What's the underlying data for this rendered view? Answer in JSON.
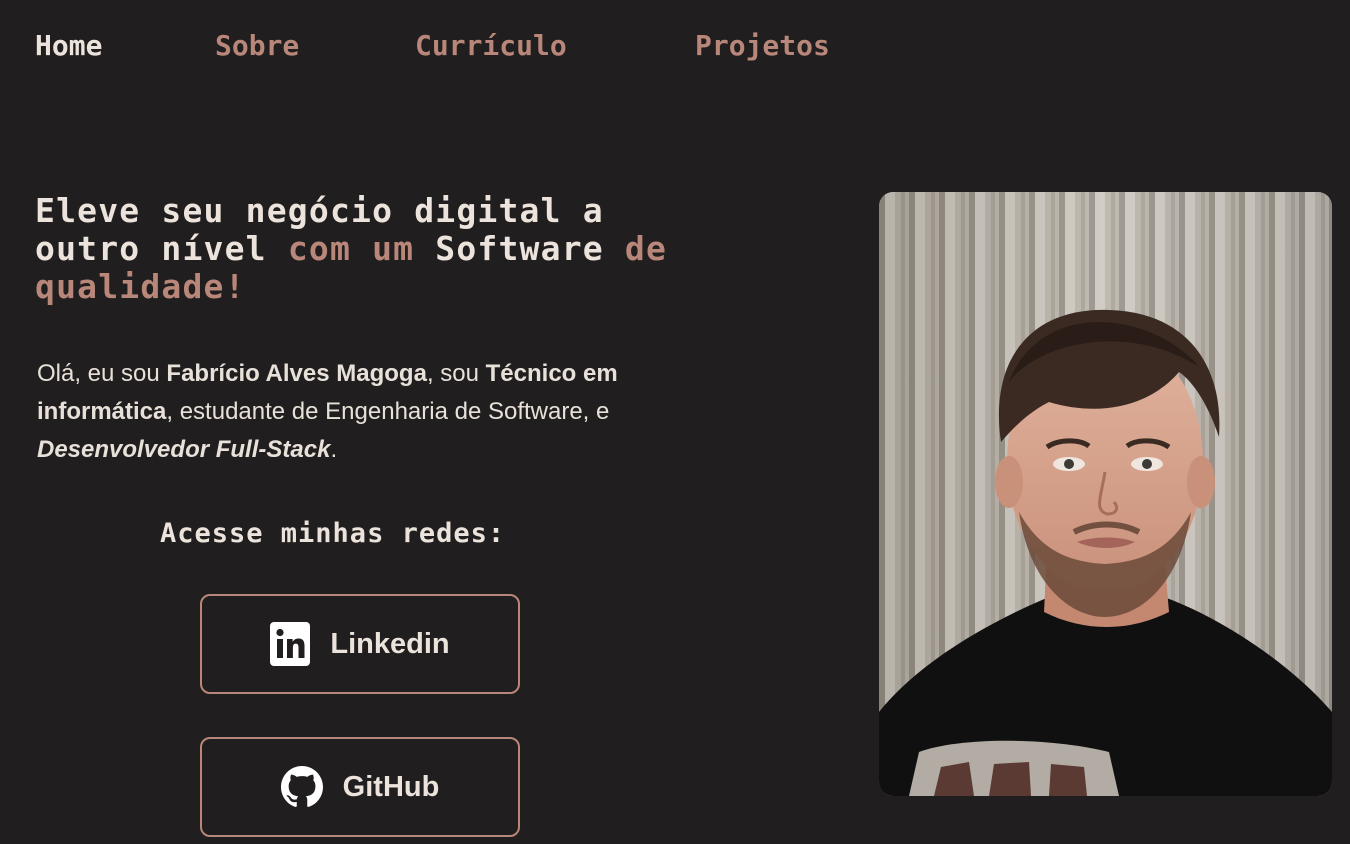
{
  "nav": {
    "home": "Home",
    "sobre": "Sobre",
    "curriculo": "Currículo",
    "projetos": "Projetos"
  },
  "hero": {
    "headline_part1": "Eleve seu negócio digital a outro nível ",
    "headline_accent1": "com um",
    "headline_part2": " Software ",
    "headline_accent2": "de qualidade!",
    "intro_1": "Olá, eu sou ",
    "intro_name": "Fabrício Alves Magoga",
    "intro_2": ", sou ",
    "intro_role": "Técnico em informática",
    "intro_3": ", estudante de Engenharia de Software, e ",
    "intro_dev": "Desenvolvedor Full-Stack",
    "intro_4": "."
  },
  "social": {
    "title": "Acesse minhas redes:",
    "linkedin_label": "Linkedin",
    "linkedin_icon": "linkedin-icon",
    "github_label": "GitHub",
    "github_icon": "github-icon"
  },
  "photo": {
    "alt": "portrait-photo"
  },
  "colors": {
    "background": "#201e1f",
    "text": "#ece4dc",
    "accent": "#b9877a"
  }
}
